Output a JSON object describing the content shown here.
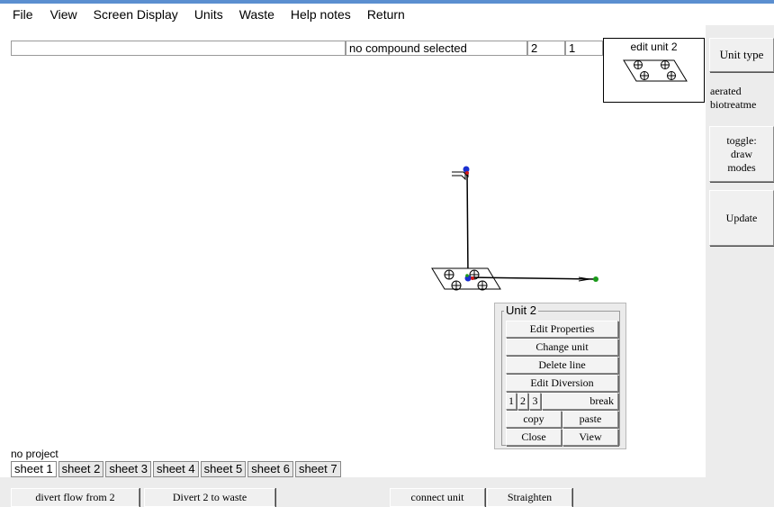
{
  "menu": [
    "File",
    "View",
    "Screen Display",
    "Units",
    "Waste",
    "Help notes",
    "Return"
  ],
  "toolbar": {
    "search_value": "",
    "compound": "no compound selected",
    "field_a": "2",
    "field_b": "1"
  },
  "preview": {
    "label": "edit unit  2"
  },
  "right_panel": {
    "unit_type_label": "Unit type",
    "unit_type_value_line1": "aerated",
    "unit_type_value_line2": "biotreatme",
    "toggle_line1": "toggle:",
    "toggle_line2": "draw",
    "toggle_line3": "modes",
    "update_label": "Update"
  },
  "popup": {
    "title": "Unit  2",
    "edit_properties": "Edit Properties",
    "change_unit": "Change unit",
    "delete_line": "Delete line",
    "edit_diversion": "Edit Diversion",
    "num1": "1",
    "num2": "2",
    "num3": "3",
    "break": "break",
    "copy": "copy",
    "paste": "paste",
    "close": "Close",
    "view": "View"
  },
  "status": "no project",
  "sheets": [
    "sheet  1",
    "sheet  2",
    "sheet  3",
    "sheet  4",
    "sheet  5",
    "sheet  6",
    "sheet  7"
  ],
  "bottom": {
    "divert_flow": "divert flow from  2",
    "divert_waste": "Divert 2 to waste",
    "connect_unit": "connect unit",
    "straighten": "Straighten"
  },
  "colors": {
    "titlebar": "#5b8fd0",
    "node_blue": "#1a2fd0",
    "node_red": "#d01a1a",
    "node_green": "#1a9a1a"
  },
  "icons": [
    "aerator-unit-icon",
    "aerator-unit-preview-icon",
    "pipe-inlet-icon",
    "outlet-arrow-icon"
  ]
}
